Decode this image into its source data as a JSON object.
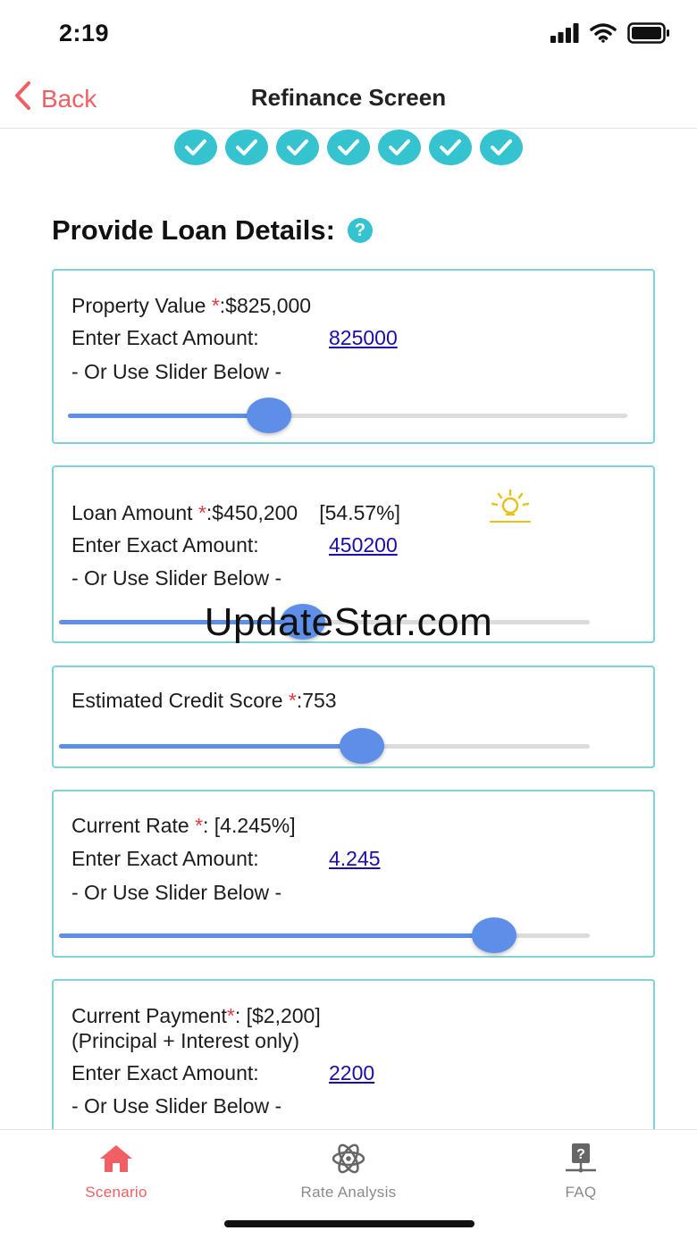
{
  "status_bar": {
    "time": "2:19"
  },
  "nav": {
    "back_label": "Back",
    "title": "Refinance Screen"
  },
  "steps": {
    "completed_count": 7
  },
  "section": {
    "title": "Provide Loan Details:",
    "help_glyph": "?"
  },
  "common": {
    "exact_label": "Enter Exact Amount:",
    "or_slider": "- Or Use Slider Below -",
    "required_mark": "*"
  },
  "property": {
    "label": "Property Value ",
    "suffix": ":$825,000",
    "exact_value": "825000",
    "slider_fraction": 0.36
  },
  "loan": {
    "label": "Loan Amount ",
    "suffix": ":$450,200",
    "percent": "[54.57%]",
    "exact_value": "450200",
    "slider_fraction": 0.46
  },
  "credit": {
    "label": "Estimated Credit Score ",
    "suffix": ":753",
    "slider_fraction": 0.57
  },
  "rate": {
    "label": "Current Rate ",
    "suffix": ": [4.245%]",
    "exact_value": "4.245",
    "slider_fraction": 0.82
  },
  "payment": {
    "label": "Current Payment",
    "suffix": ": [$2,200]",
    "note": "(Principal + Interest only)",
    "exact_value": "2200"
  },
  "watermark": "UpdateStar.com",
  "tabs": [
    {
      "label": "Scenario",
      "icon": "home-icon",
      "active": true
    },
    {
      "label": "Rate Analysis",
      "icon": "atom-icon",
      "active": false
    },
    {
      "label": "FAQ",
      "icon": "question-board-icon",
      "active": false
    }
  ],
  "colors": {
    "accent": "#35c4cf",
    "back": "#ef5f63",
    "slider": "#5d8fe8",
    "link": "#1a0dab",
    "active_tab": "#ef5f63",
    "inactive_tab": "#8a8a8a"
  }
}
